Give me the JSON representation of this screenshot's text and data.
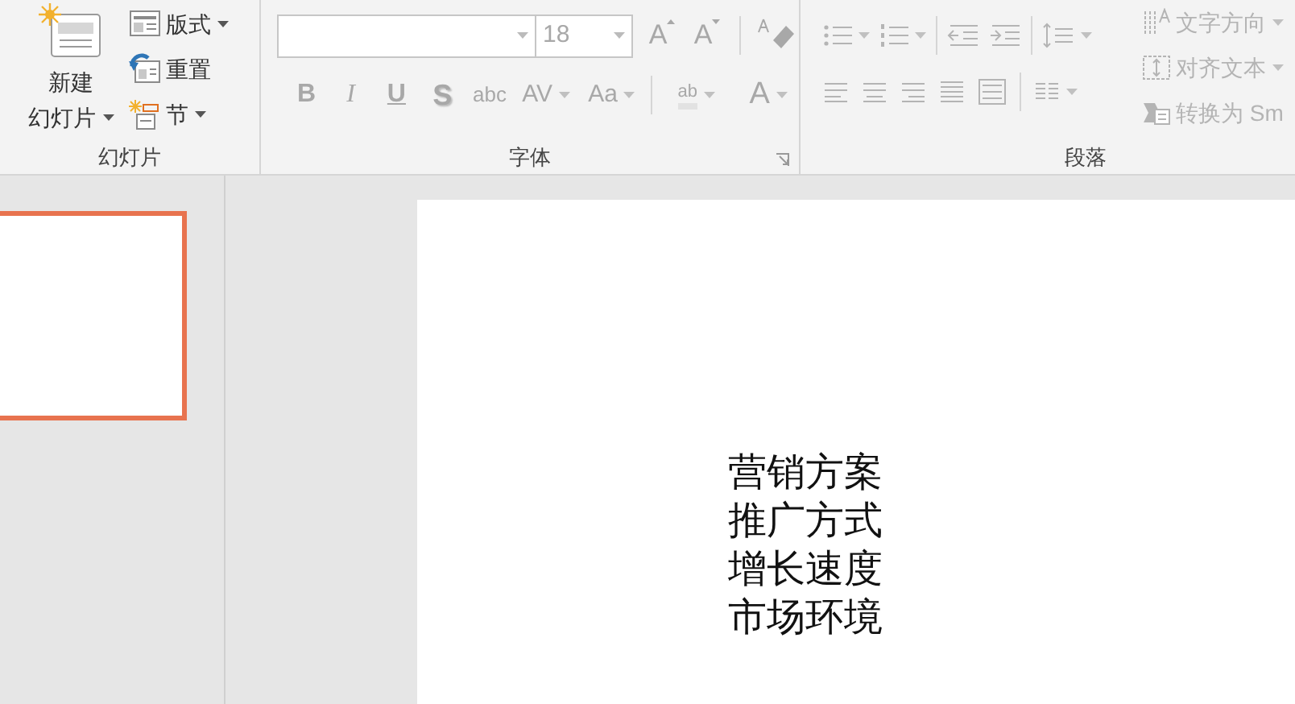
{
  "slides_group": {
    "label": "幻灯片",
    "new_slide": {
      "line1": "新建",
      "line2": "幻灯片",
      "dropdown": true
    },
    "small_buttons": [
      {
        "kind": "layout",
        "label": "版式",
        "dropdown": true
      },
      {
        "kind": "reset",
        "label": "重置",
        "dropdown": false
      },
      {
        "kind": "section",
        "label": "节",
        "dropdown": true
      }
    ]
  },
  "font_group": {
    "label": "字体",
    "disabled": true,
    "size_field": {
      "value": "18"
    },
    "size_buttons": [
      {
        "kind": "grow",
        "text": "A"
      },
      {
        "kind": "shrink",
        "text": "A"
      }
    ],
    "format_buttons": [
      {
        "kind": "bold",
        "text": "B",
        "dropdown": false
      },
      {
        "kind": "italic",
        "text": "I",
        "dropdown": false
      },
      {
        "kind": "underline",
        "text": "U",
        "dropdown": false
      },
      {
        "kind": "shadow",
        "text": "S",
        "dropdown": false
      },
      {
        "kind": "strike",
        "text": "abc",
        "dropdown": false
      },
      {
        "kind": "spacing",
        "text": "AV",
        "dropdown": true
      },
      {
        "kind": "case",
        "text": "Aa",
        "dropdown": true
      },
      {
        "kind": "highlight",
        "text": "ab",
        "dropdown": true
      },
      {
        "kind": "color",
        "text": "A",
        "dropdown": true
      }
    ]
  },
  "paragraph_group": {
    "label": "段落",
    "disabled": true,
    "side_buttons": [
      {
        "kind": "direction",
        "label": "文字方向",
        "dropdown": true
      },
      {
        "kind": "align",
        "label": "对齐文本",
        "dropdown": true
      },
      {
        "kind": "smartart",
        "label": "转换为 Sm",
        "dropdown": false
      }
    ]
  },
  "thumbnail": {
    "selected": true
  },
  "slide": {
    "lines": [
      "营销方案",
      "推广方式",
      "增长速度",
      "市场环境"
    ]
  }
}
